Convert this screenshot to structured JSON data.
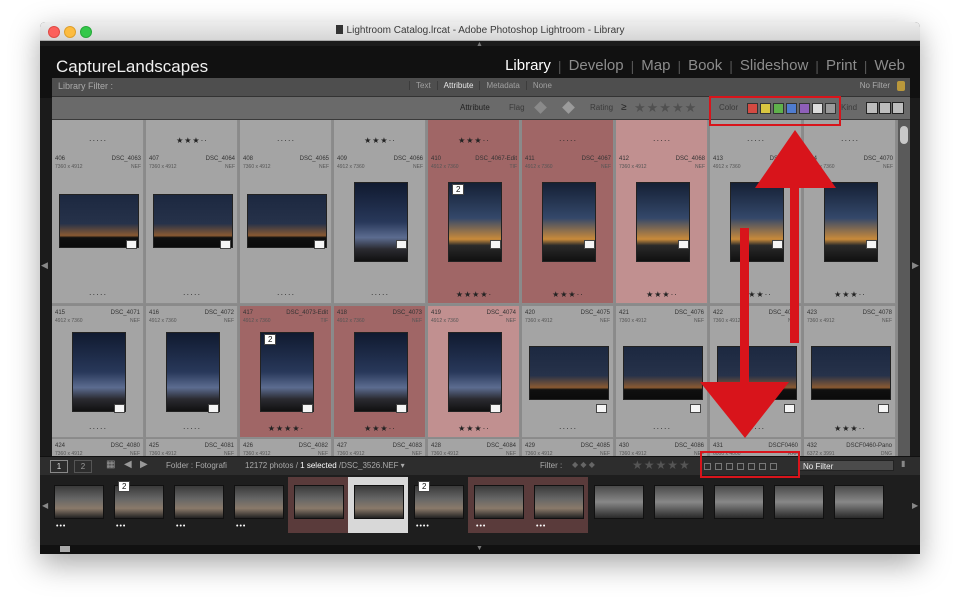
{
  "window": {
    "title": "Lightroom Catalog.lrcat - Adobe Photoshop Lightroom - Library"
  },
  "header": {
    "brand": "CaptureLandscapes",
    "modules": [
      {
        "label": "Library",
        "active": true
      },
      {
        "label": "Develop",
        "active": false
      },
      {
        "label": "Map",
        "active": false
      },
      {
        "label": "Book",
        "active": false
      },
      {
        "label": "Slideshow",
        "active": false
      },
      {
        "label": "Print",
        "active": false
      },
      {
        "label": "Web",
        "active": false
      }
    ]
  },
  "library_filter": {
    "title": "Library Filter :",
    "tabs": [
      "Text",
      "Attribute",
      "Metadata",
      "None"
    ],
    "active_tab": "Attribute",
    "preset": "No Filter"
  },
  "attribute_bar": {
    "attribute_label": "Attribute",
    "flag_label": "Flag",
    "rating_label": "Rating",
    "rating_op": "≥",
    "rating_stars": "★★★★★",
    "color_label": "Color",
    "colors": [
      "#d34a42",
      "#d9c640",
      "#5fb14b",
      "#4f7ccf",
      "#8e5fb8",
      "#dcdcdc",
      "#9a9a9a"
    ],
    "kind_label": "Kind"
  },
  "grid": {
    "rows": [
      [
        {
          "num": "406",
          "name": "DSC_4063",
          "dim": "7360 x 4912",
          "ext": "NEF",
          "top_stars": "·····",
          "stars": "·····",
          "orient": "h"
        },
        {
          "num": "407",
          "name": "DSC_4064",
          "dim": "7360 x 4912",
          "ext": "NEF",
          "top_stars": "★★★··",
          "stars": "·····",
          "orient": "h"
        },
        {
          "num": "408",
          "name": "DSC_4065",
          "dim": "7360 x 4912",
          "ext": "NEF",
          "top_stars": "·····",
          "stars": "·····",
          "orient": "h"
        },
        {
          "num": "409",
          "name": "DSC_4066",
          "dim": "4912 x 7360",
          "ext": "NEF",
          "top_stars": "★★★··",
          "stars": "·····",
          "orient": "v"
        },
        {
          "num": "410",
          "name": "DSC_4067-Edit",
          "dim": "4912 x 7360",
          "ext": "TIF",
          "top_stars": "★★★··",
          "stars": "★★★★·",
          "orient": "v",
          "style": "pick",
          "badge": "2"
        },
        {
          "num": "411",
          "name": "DSC_4067",
          "dim": "4912 x 7360",
          "ext": "NEF",
          "top_stars": "·····",
          "stars": "★★★··",
          "orient": "v",
          "style": "pick"
        },
        {
          "num": "412",
          "name": "DSC_4068",
          "dim": "7360 x 4912",
          "ext": "NEF",
          "top_stars": "·····",
          "stars": "★★★··",
          "orient": "v",
          "style": "pickl"
        },
        {
          "num": "413",
          "name": "DSC_4069",
          "dim": "4912 x 7360",
          "ext": "NEF",
          "top_stars": "·····",
          "stars": "★★★··",
          "orient": "v"
        },
        {
          "num": "414",
          "name": "DSC_4070",
          "dim": "4912 x 7360",
          "ext": "NEF",
          "top_stars": "·····",
          "stars": "★★★··",
          "orient": "v"
        }
      ],
      [
        {
          "num": "415",
          "name": "DSC_4071",
          "dim": "4912 x 7360",
          "ext": "NEF",
          "stars": "·····",
          "orient": "v"
        },
        {
          "num": "416",
          "name": "DSC_4072",
          "dim": "4912 x 7360",
          "ext": "NEF",
          "stars": "·····",
          "orient": "v"
        },
        {
          "num": "417",
          "name": "DSC_4073-Edit",
          "dim": "4912 x 7360",
          "ext": "TIF",
          "stars": "★★★★·",
          "orient": "v",
          "style": "pick",
          "badge": "2"
        },
        {
          "num": "418",
          "name": "DSC_4073",
          "dim": "4912 x 7360",
          "ext": "NEF",
          "stars": "★★★··",
          "orient": "v",
          "style": "pick"
        },
        {
          "num": "419",
          "name": "DSC_4074",
          "dim": "4912 x 7360",
          "ext": "NEF",
          "stars": "★★★··",
          "orient": "v",
          "style": "pickl"
        },
        {
          "num": "420",
          "name": "DSC_4075",
          "dim": "7360 x 4912",
          "ext": "NEF",
          "stars": "·····",
          "orient": "h"
        },
        {
          "num": "421",
          "name": "DSC_4076",
          "dim": "7360 x 4912",
          "ext": "NEF",
          "stars": "·····",
          "orient": "h"
        },
        {
          "num": "422",
          "name": "DSC_4077",
          "dim": "7360 x 4912",
          "ext": "NEF",
          "stars": "·····",
          "orient": "h"
        },
        {
          "num": "423",
          "name": "DSC_4078",
          "dim": "7360 x 4912",
          "ext": "NEF",
          "stars": "★★★··",
          "orient": "h"
        }
      ],
      [
        {
          "num": "424",
          "name": "DSC_4080",
          "dim": "7360 x 4912",
          "ext": "NEF"
        },
        {
          "num": "425",
          "name": "DSC_4081",
          "dim": "7360 x 4912",
          "ext": "NEF"
        },
        {
          "num": "426",
          "name": "DSC_4082",
          "dim": "7360 x 4912",
          "ext": "NEF"
        },
        {
          "num": "427",
          "name": "DSC_4083",
          "dim": "7360 x 4912",
          "ext": "NEF"
        },
        {
          "num": "428",
          "name": "DSC_4084",
          "dim": "7360 x 4912",
          "ext": "NEF"
        },
        {
          "num": "429",
          "name": "DSC_4085",
          "dim": "7360 x 4912",
          "ext": "NEF"
        },
        {
          "num": "430",
          "name": "DSC_4086",
          "dim": "7360 x 4912",
          "ext": "NEF"
        },
        {
          "num": "431",
          "name": "DSCF0460",
          "dim": "6000 x 4000",
          "ext": "RAF"
        },
        {
          "num": "432",
          "name": "DSCF0460-Pano",
          "dim": "6372 x 3991",
          "ext": "DNG"
        }
      ]
    ]
  },
  "filmstrip_bar": {
    "monitor1": "1",
    "monitor2": "2",
    "folder_label": "Folder : Fotografi",
    "count": "12172 photos /",
    "selected": "1 selected",
    "file": "/DSC_3526.NEF ▾",
    "filter_label": "Filter :",
    "stars": "★★★★★",
    "filter_preset": "No Filter"
  },
  "filmstrip": {
    "items": [
      {
        "dots": "•••",
        "style": "normal"
      },
      {
        "dots": "•••",
        "style": "normal",
        "badge": "2"
      },
      {
        "dots": "•••",
        "style": "normal"
      },
      {
        "dots": "•••",
        "style": "normal"
      },
      {
        "dots": "",
        "style": "pick"
      },
      {
        "dots": "",
        "style": "sel"
      },
      {
        "dots": "••••",
        "style": "normal",
        "badge": "2"
      },
      {
        "dots": "•••",
        "style": "pick"
      },
      {
        "dots": "•••",
        "style": "pick"
      },
      {
        "dots": "",
        "style": "normal"
      },
      {
        "dots": "",
        "style": "normal"
      },
      {
        "dots": "",
        "style": "normal"
      },
      {
        "dots": "",
        "style": "normal"
      },
      {
        "dots": "",
        "style": "normal"
      }
    ]
  },
  "annotations": {
    "color": "#d8141b"
  }
}
